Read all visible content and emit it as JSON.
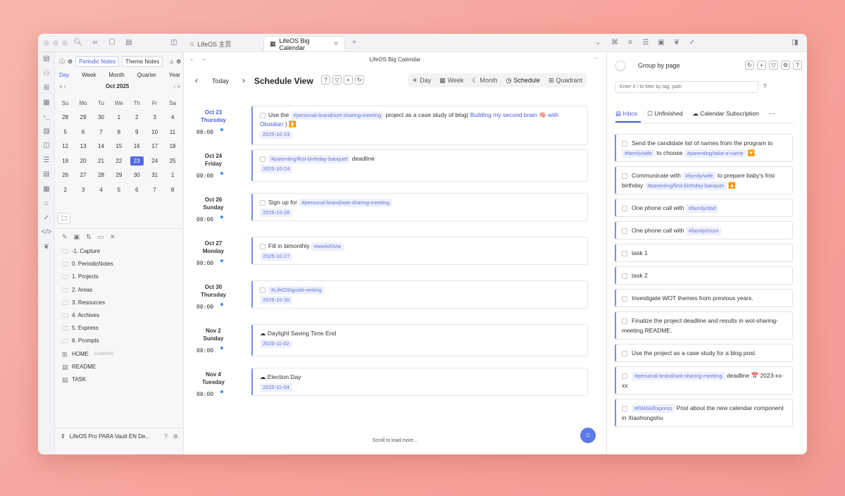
{
  "tabs": [
    {
      "label": "LifeOS 主页",
      "active": false
    },
    {
      "label": "LifeOS Big Calendar",
      "active": true
    }
  ],
  "sidebar": {
    "mode_tabs": [
      "Periodic Notes",
      "Theme Notes"
    ],
    "periods": [
      "Day",
      "Week",
      "Month",
      "Quarter",
      "Year"
    ],
    "calendar_month": "Oct  2025",
    "weekdays": [
      "Su",
      "Mo",
      "Tu",
      "We",
      "Th",
      "Fr",
      "Sa"
    ],
    "weeks": [
      [
        "28",
        "29",
        "30",
        "1",
        "2",
        "3",
        "4"
      ],
      [
        "5",
        "6",
        "7",
        "8",
        "9",
        "10",
        "11"
      ],
      [
        "12",
        "13",
        "14",
        "15",
        "16",
        "17",
        "18"
      ],
      [
        "19",
        "20",
        "21",
        "22",
        "23",
        "24",
        "25"
      ],
      [
        "26",
        "27",
        "28",
        "29",
        "30",
        "31",
        "1"
      ],
      [
        "2",
        "3",
        "4",
        "5",
        "6",
        "7",
        "8"
      ]
    ],
    "selected_day": "23",
    "tree": [
      {
        "label": "-1. Capture",
        "type": "folder"
      },
      {
        "label": "0. PeriodicNotes",
        "type": "folder"
      },
      {
        "label": "1. Projects",
        "type": "folder"
      },
      {
        "label": "2. Areas",
        "type": "folder"
      },
      {
        "label": "3. Resources",
        "type": "folder"
      },
      {
        "label": "4. Archives",
        "type": "folder"
      },
      {
        "label": "5. Express",
        "type": "folder"
      },
      {
        "label": "6. Prompts",
        "type": "folder"
      },
      {
        "label": "HOME",
        "type": "canvas",
        "badge": "CANVAS"
      },
      {
        "label": "README",
        "type": "file"
      },
      {
        "label": "TASK",
        "type": "file"
      }
    ],
    "vault_name": "LifeOS Pro PARA Vault EN De..."
  },
  "main": {
    "window_title": "LifeOS Big Calendar",
    "today_label": "Today",
    "view_title": "Schedule View",
    "views": [
      "Day",
      "Week",
      "Month",
      "Schedule",
      "Quadrant"
    ],
    "active_view": "Schedule",
    "days": [
      {
        "date": "Oct 23",
        "weekday": "Thursday",
        "time": "00:00",
        "today": true,
        "text_pre": "Use the",
        "tag": "#personal-brand/wot-sharing-meeting",
        "text_mid": "project as a case study of blog(",
        "link": "Building my second brain 🧠 with Obsidian",
        "text_post": ") ⏫",
        "chip": "2025-10-23"
      },
      {
        "date": "Oct 24",
        "weekday": "Friday",
        "time": "00:00",
        "today": false,
        "tag": "#parenting/first-birthday-banquet",
        "text_mid": "deadline",
        "chip": "2025-10-24"
      },
      {
        "date": "Oct 26",
        "weekday": "Sunday",
        "time": "00:00",
        "today": false,
        "text_pre": "Sign up for",
        "tag": "#personal-brand/wot-sharing-meeting",
        "chip": "2025-10-26"
      },
      {
        "date": "Oct 27",
        "weekday": "Monday",
        "time": "00:00",
        "today": false,
        "text_pre": "Fill in bimonthly",
        "tag": "#work/trivia",
        "chip": "2025-10-27"
      },
      {
        "date": "Oct 30",
        "weekday": "Thursday",
        "time": "00:00",
        "today": false,
        "tag": "#LifeOS/guide-writing",
        "chip": "2025-10-30"
      },
      {
        "date": "Nov 2",
        "weekday": "Sunday",
        "time": "00:00",
        "today": false,
        "holiday": "Daylight Saving Time End",
        "chip": "2025-11-02"
      },
      {
        "date": "Nov 4",
        "weekday": "Tuesday",
        "time": "00:00",
        "today": false,
        "holiday": "Election Day",
        "chip": "2025-11-04"
      }
    ],
    "scroll_more": "Scroll to load more..."
  },
  "right": {
    "group_label": "Group by page",
    "filter_placeholder": "Enter # / to filter by tag, path",
    "tabs": [
      "Inbox",
      "Unfinished",
      "Calendar Subscription"
    ],
    "tasks": [
      {
        "parts": [
          [
            "t",
            "Send the candidate list of names from the program to "
          ],
          [
            "g",
            "#family/wife"
          ],
          [
            "t",
            " to choose "
          ],
          [
            "g",
            "#parenting/take-a-name"
          ],
          [
            "t",
            " 🔽"
          ]
        ]
      },
      {
        "parts": [
          [
            "t",
            "Communicate with "
          ],
          [
            "g",
            "#family/wife"
          ],
          [
            "t",
            " to prepare baby's frist birthday "
          ],
          [
            "g",
            "#parenting/first-birthday-banquet"
          ],
          [
            "t",
            " 🔼"
          ]
        ]
      },
      {
        "parts": [
          [
            "t",
            "One phone call with "
          ],
          [
            "g",
            "#family/dad"
          ]
        ]
      },
      {
        "parts": [
          [
            "t",
            "One phone call with "
          ],
          [
            "g",
            "#family/mom"
          ]
        ]
      },
      {
        "parts": [
          [
            "t",
            "task 1"
          ]
        ]
      },
      {
        "parts": [
          [
            "t",
            "task 2"
          ]
        ]
      },
      {
        "parts": [
          [
            "t",
            "Investigate WOT themes from previous years."
          ]
        ]
      },
      {
        "parts": [
          [
            "t",
            "Finalize the project deadline and results in wot-sharing-meeting.README."
          ]
        ]
      },
      {
        "parts": [
          [
            "t",
            "Use the project as a case study for a blog post."
          ]
        ]
      },
      {
        "parts": [
          [
            "g",
            "#personal-brand/wot-sharing-meeting"
          ],
          [
            "t",
            " deadline 📅 2023-xx-xx"
          ]
        ]
      },
      {
        "parts": [
          [
            "g",
            "#PARA/Express"
          ],
          [
            "t",
            " Post about the new calendar component in Xiaohongshu"
          ]
        ]
      }
    ]
  }
}
